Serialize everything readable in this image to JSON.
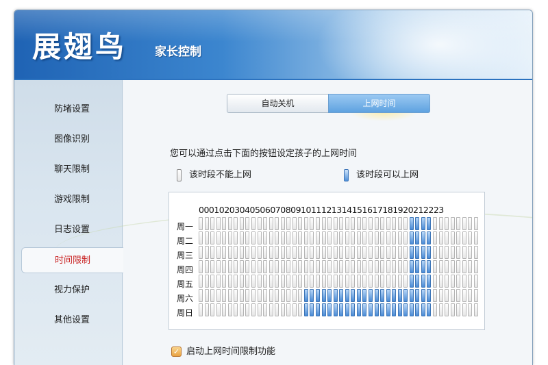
{
  "header": {
    "brand": "展翅鸟",
    "subtitle": "家长控制"
  },
  "sidebar": {
    "items": [
      {
        "label": "防堵设置",
        "active": false
      },
      {
        "label": "图像识别",
        "active": false
      },
      {
        "label": "聊天限制",
        "active": false
      },
      {
        "label": "游戏限制",
        "active": false
      },
      {
        "label": "日志设置",
        "active": false
      },
      {
        "label": "时间限制",
        "active": true
      },
      {
        "label": "视力保护",
        "active": false
      },
      {
        "label": "其他设置",
        "active": false
      }
    ]
  },
  "tabs": [
    {
      "label": "自动关机",
      "selected": false
    },
    {
      "label": "上网时间",
      "selected": true
    }
  ],
  "instruction": "您可以通过点击下面的按钮设定孩子的上网时间",
  "legend": {
    "off_label": "该时段不能上网",
    "on_label": "该时段可以上网"
  },
  "schedule": {
    "hours_header": "000102030405060708091011121314151617181920212223",
    "days": [
      "周一",
      "周二",
      "周三",
      "周四",
      "周五",
      "周六",
      "周日"
    ],
    "cells_per_day": 48,
    "allowed_ranges": [
      [
        [
          36,
          40
        ]
      ],
      [
        [
          36,
          40
        ]
      ],
      [
        [
          36,
          40
        ]
      ],
      [
        [
          36,
          40
        ]
      ],
      [
        [
          36,
          40
        ]
      ],
      [
        [
          18,
          40
        ]
      ],
      [
        [
          18,
          40
        ]
      ]
    ]
  },
  "enable": {
    "label": "启动上网时间限制功能",
    "checked": true
  },
  "colors": {
    "accent": "#2b72bf",
    "active_nav_text": "#c81e1e",
    "allowed_cell": "#4a8bd6"
  }
}
